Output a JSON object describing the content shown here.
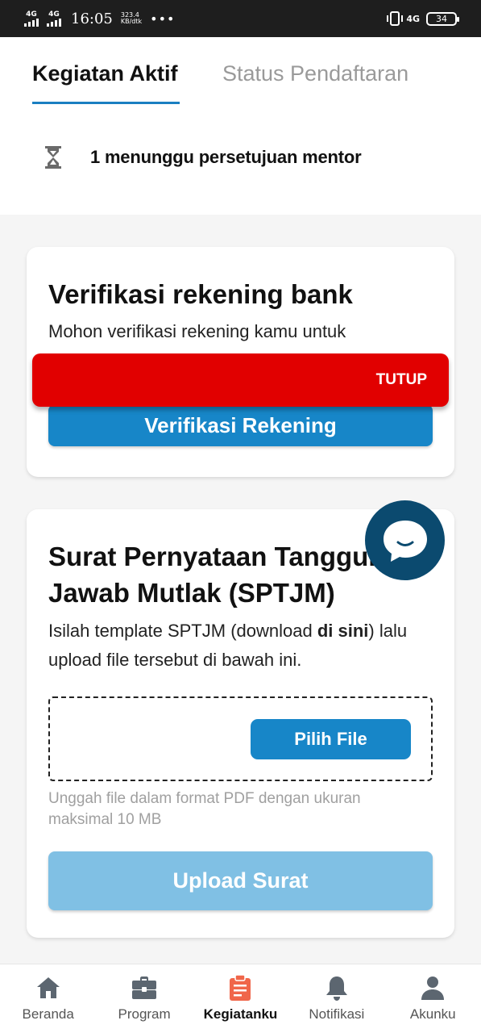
{
  "status_bar": {
    "net1": "4G",
    "net2": "4G",
    "time": "16:05",
    "speed_value": "323.4",
    "speed_unit": "KB/dtk",
    "more": "•••",
    "network_right": "4G",
    "battery": "34"
  },
  "tabs": [
    {
      "label": "Kegiatan Aktif",
      "active": true
    },
    {
      "label": "Status Pendaftaran",
      "active": false
    }
  ],
  "pending": {
    "text": "1 menunggu persetujuan mentor",
    "icon": "hourglass-icon"
  },
  "bank_card": {
    "title": "Verifikasi rekening bank",
    "description": "Mohon verifikasi rekening kamu untuk",
    "button": "Verifikasi Rekening"
  },
  "toast": {
    "close_label": "TUTUP",
    "color": "#e10000"
  },
  "sptjm_card": {
    "title_line1": "Surat Pernyataan Tanggung",
    "title_line2": "Jawab Mutlak (SPTJM)",
    "desc_prefix": "Isilah template SPTJM (download ",
    "desc_link": "di sini",
    "desc_suffix": ") lalu",
    "desc_line2": "upload file tersebut di bawah ini.",
    "pick_button": "Pilih File",
    "hint": "Unggah file dalam format PDF dengan ukuran maksimal 10 MB",
    "upload_button": "Upload Surat"
  },
  "bottom_nav": [
    {
      "label": "Beranda",
      "icon": "home-icon",
      "active": false
    },
    {
      "label": "Program",
      "icon": "briefcase-icon",
      "active": false
    },
    {
      "label": "Kegiatanku",
      "icon": "clipboard-icon",
      "active": true
    },
    {
      "label": "Notifikasi",
      "icon": "bell-icon",
      "active": false
    },
    {
      "label": "Akunku",
      "icon": "user-icon",
      "active": false
    }
  ],
  "colors": {
    "accent": "#1786c8",
    "active_nav": "#f0664a",
    "inactive_nav": "#5c6670",
    "chat_fab": "#0b4a6f"
  }
}
